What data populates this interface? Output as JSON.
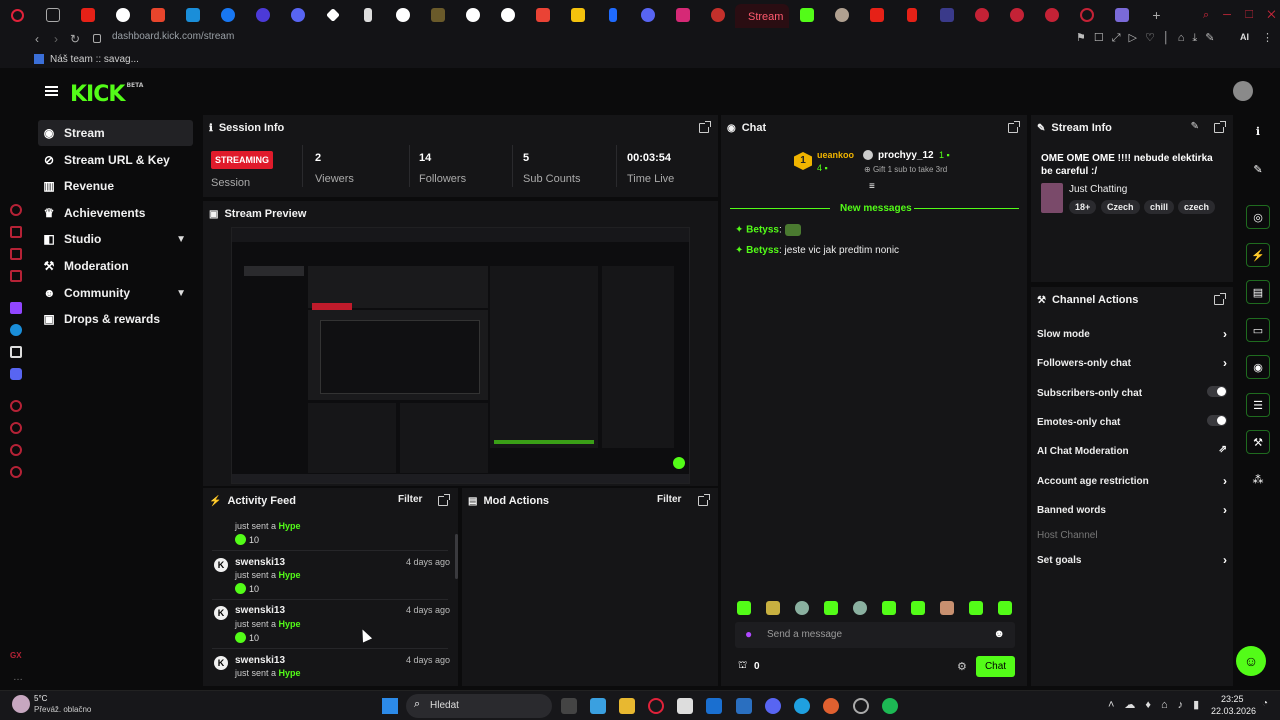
{
  "browser": {
    "active_tab": "Stream",
    "url": "dashboard.kick.com/stream",
    "bookmark": "Náš team :: savag..."
  },
  "brand": {
    "logo": "KICK",
    "beta": "BETA"
  },
  "nav": [
    {
      "label": "Stream",
      "icon": "broadcast-icon"
    },
    {
      "label": "Stream URL & Key",
      "icon": "link-icon"
    },
    {
      "label": "Revenue",
      "icon": "chart-icon"
    },
    {
      "label": "Achievements",
      "icon": "trophy-icon"
    },
    {
      "label": "Studio",
      "icon": "layers-icon"
    },
    {
      "label": "Moderation",
      "icon": "gavel-icon"
    },
    {
      "label": "Community",
      "icon": "people-icon"
    },
    {
      "label": "Drops & rewards",
      "icon": "gift-icon"
    }
  ],
  "session": {
    "title": "Session Info",
    "status": "STREAMING",
    "session_label": "Session",
    "stats": [
      {
        "value": "2",
        "label": "Viewers"
      },
      {
        "value": "14",
        "label": "Followers"
      },
      {
        "value": "5",
        "label": "Sub Counts"
      },
      {
        "value": "00:03:54",
        "label": "Time Live"
      }
    ]
  },
  "preview": {
    "title": "Stream Preview"
  },
  "activity": {
    "title": "Activity Feed",
    "filter": "Filter",
    "items": [
      {
        "name": "",
        "prefix": "just sent a",
        "hype": "Hype",
        "amount": "10",
        "time": ""
      },
      {
        "name": "swenski13",
        "prefix": "just sent a",
        "hype": "Hype",
        "amount": "10",
        "time": "4 days ago"
      },
      {
        "name": "swenski13",
        "prefix": "just sent a",
        "hype": "Hype",
        "amount": "10",
        "time": "4 days ago"
      },
      {
        "name": "swenski13",
        "prefix": "just sent a",
        "hype": "Hype",
        "amount": "",
        "time": "4 days ago"
      }
    ]
  },
  "mod_actions": {
    "title": "Mod Actions",
    "filter": "Filter"
  },
  "chat": {
    "title": "Chat",
    "pinned": {
      "user1": "ueankoo",
      "count1": "4",
      "user2": "prochyy_12",
      "count2": "1",
      "note": "Gift 1 sub to take 3rd"
    },
    "new_messages": "New messages",
    "messages": [
      {
        "user": "Betyss",
        "text": ""
      },
      {
        "user": "Betyss",
        "text": "jeste vic jak predtim nonic"
      }
    ],
    "placeholder": "Send a message",
    "points": "0",
    "send": "Chat"
  },
  "stream_info": {
    "title": "Stream Info",
    "stream_title": "OME OME OME !!!! nebude elektirka be careful :/",
    "category": "Just Chatting",
    "tags": [
      "18+",
      "Czech",
      "chill",
      "czech"
    ]
  },
  "channel_actions": {
    "title": "Channel Actions",
    "items": [
      {
        "label": "Slow mode",
        "control": "arrow"
      },
      {
        "label": "Followers-only chat",
        "control": "arrow"
      },
      {
        "label": "Subscribers-only chat",
        "control": "toggle"
      },
      {
        "label": "Emotes-only chat",
        "control": "toggle"
      },
      {
        "label": "AI Chat Moderation",
        "control": "external"
      },
      {
        "label": "Account age restriction",
        "control": "arrow"
      },
      {
        "label": "Banned words",
        "control": "arrow"
      },
      {
        "label": "Host Channel",
        "control": "disabled"
      },
      {
        "label": "Set goals",
        "control": "arrow"
      }
    ]
  },
  "taskbar": {
    "weather_temp": "5°C",
    "weather_desc": "Převáž. oblačno",
    "search": "Hledat",
    "time": "23:25",
    "date": "22.03.2026"
  },
  "colors": {
    "accent": "#53fc18",
    "live": "#e01b2b",
    "panel": "#151517"
  }
}
